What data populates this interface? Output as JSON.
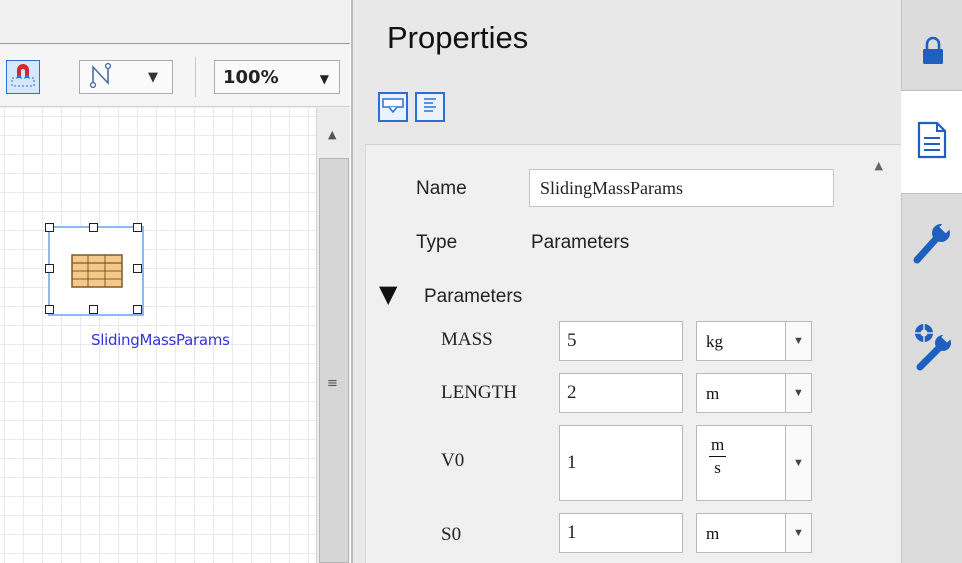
{
  "canvas": {
    "zoom": "100%",
    "block_label": "SlidingMassParams",
    "scrollbar_grip": "≡",
    "scroll_up": "▲"
  },
  "properties": {
    "title": "Properties",
    "name_label": "Name",
    "name_value": "SlidingMassParams",
    "type_label": "Type",
    "type_value": "Parameters",
    "section_toggle": "▼",
    "section_title": "Parameters",
    "params": [
      {
        "name": "MASS",
        "value": "5",
        "unit": "kg"
      },
      {
        "name": "LENGTH",
        "value": "2",
        "unit": "m"
      },
      {
        "name": "V0",
        "value": "1",
        "unit_num": "m",
        "unit_den": "s"
      },
      {
        "name": "S0",
        "value": "1",
        "unit": "m"
      }
    ],
    "dropdown_arrow": "▼"
  },
  "colors": {
    "accent": "#2a6fd6",
    "selection_border": "#8fb9ec",
    "block_label": "#3535d8",
    "strip_icon": "#1f5fbf"
  },
  "icons": [
    "magnet-snap-icon",
    "connector-icon",
    "view-mode-icon",
    "text-view-icon",
    "lock-icon",
    "document-icon",
    "wrench-icon",
    "settings-wrench-icon",
    "table-icon"
  ]
}
